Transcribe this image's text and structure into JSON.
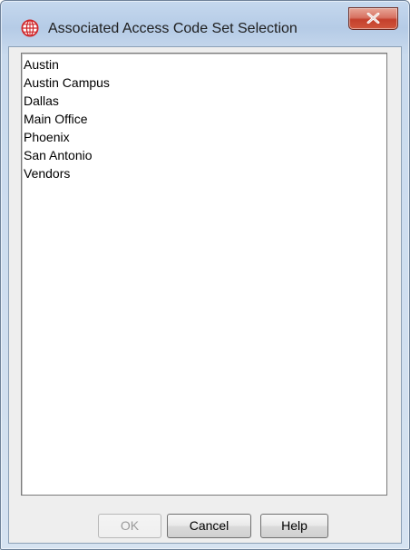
{
  "window": {
    "title": "Associated Access Code Set Selection",
    "icon": "globe-grid-icon",
    "close_icon": "close-x-icon"
  },
  "list": {
    "items": [
      "Austin",
      "Austin Campus",
      "Dallas",
      "Main Office",
      "Phoenix",
      "San Antonio",
      "Vendors"
    ]
  },
  "buttons": {
    "ok": {
      "label": "OK",
      "enabled": false
    },
    "cancel": {
      "label": "Cancel",
      "enabled": true
    },
    "help": {
      "label": "Help",
      "enabled": true
    }
  },
  "colors": {
    "title_bar": "#b9cee8",
    "close_button": "#c9503a",
    "app_icon": "#d0262a",
    "dialog_body": "#eeeeee"
  }
}
